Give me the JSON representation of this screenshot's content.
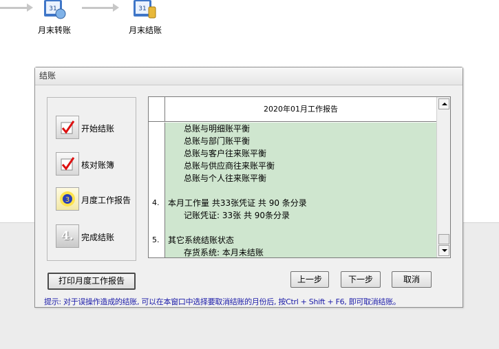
{
  "flow": {
    "items": [
      {
        "label": "月末转账"
      },
      {
        "label": "月末结账"
      }
    ]
  },
  "dialog": {
    "title": "结账",
    "steps": [
      {
        "label": "开始结账",
        "icon": "check-icon"
      },
      {
        "label": "核对账簿",
        "icon": "check-icon"
      },
      {
        "label": "月度工作报告",
        "icon": "report-icon"
      },
      {
        "label": "完成结账",
        "icon": "step-four-icon",
        "glyph": "4."
      }
    ],
    "report": {
      "title": "2020年01月工作报告",
      "rows": [
        {
          "num": "",
          "text": "总账与明细账平衡",
          "level": 2
        },
        {
          "num": "",
          "text": "总账与部门账平衡",
          "level": 2
        },
        {
          "num": "",
          "text": "总账与客户往来账平衡",
          "level": 2
        },
        {
          "num": "",
          "text": "总账与供应商往来账平衡",
          "level": 2
        },
        {
          "num": "",
          "text": "总账与个人往来账平衡",
          "level": 2
        },
        {
          "num": "",
          "text": "",
          "level": 1
        },
        {
          "num": "4.",
          "text": "本月工作量 共33张凭证 共 90 条分录",
          "level": 1
        },
        {
          "num": "",
          "text": "记账凭证: 33张   共   90条分录",
          "level": 2
        },
        {
          "num": "",
          "text": "",
          "level": 1
        },
        {
          "num": "5.",
          "text": "其它系统结账状态",
          "level": 1
        },
        {
          "num": "",
          "text": "存货系统: 本月未结账",
          "level": 2
        }
      ]
    },
    "buttons": {
      "print": "打印月度工作报告",
      "prev": "上一步",
      "next": "下一步",
      "cancel": "取消"
    },
    "hint": "提示: 对于误操作造成的结账, 可以在本窗口中选择要取消结账的月份后, 按Ctrl + Shift + F6, 即可取消结账。"
  },
  "colors": {
    "row_bg": "#cfe6cf",
    "hint_text": "#1a1aa8"
  }
}
